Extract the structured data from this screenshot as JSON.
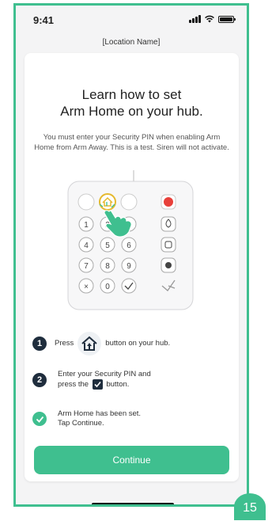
{
  "status_bar": {
    "time": "9:41",
    "icons": [
      "signal-icon",
      "wifi-icon",
      "battery-icon"
    ]
  },
  "header": {
    "location": "[Location Name]"
  },
  "card": {
    "title_line1": "Learn how to set",
    "title_line2": "Arm Home on your hub.",
    "description": "You must enter your Security PIN when enabling Arm Home from Arm Away. This is a test. Siren will not activate."
  },
  "keypad": {
    "keys": [
      "1",
      "2",
      "3",
      "4",
      "5",
      "6",
      "7",
      "8",
      "9",
      "0"
    ],
    "icons": [
      "arm-away-icon",
      "arm-home-icon",
      "disarm-icon",
      "siren-icon",
      "fire-icon",
      "police-icon",
      "medical-icon",
      "cancel-icon",
      "confirm-icon",
      "logo-icon"
    ]
  },
  "steps": [
    {
      "number": "1",
      "text_before": "Press",
      "icon": "arm-home-icon",
      "text_after": "button on your hub."
    },
    {
      "number": "2",
      "line1": "Enter your Security PIN and",
      "line2_before": "press the",
      "icon": "checkbox-icon",
      "line2_after": "button."
    },
    {
      "icon": "check-icon",
      "line1": "Arm Home has been set.",
      "line2": "Tap Continue."
    }
  ],
  "continue_label": "Continue",
  "page_number": "15",
  "colors": {
    "accent": "#3fbf8f",
    "dark": "#1f2d3d",
    "siren": "#e8403a"
  }
}
